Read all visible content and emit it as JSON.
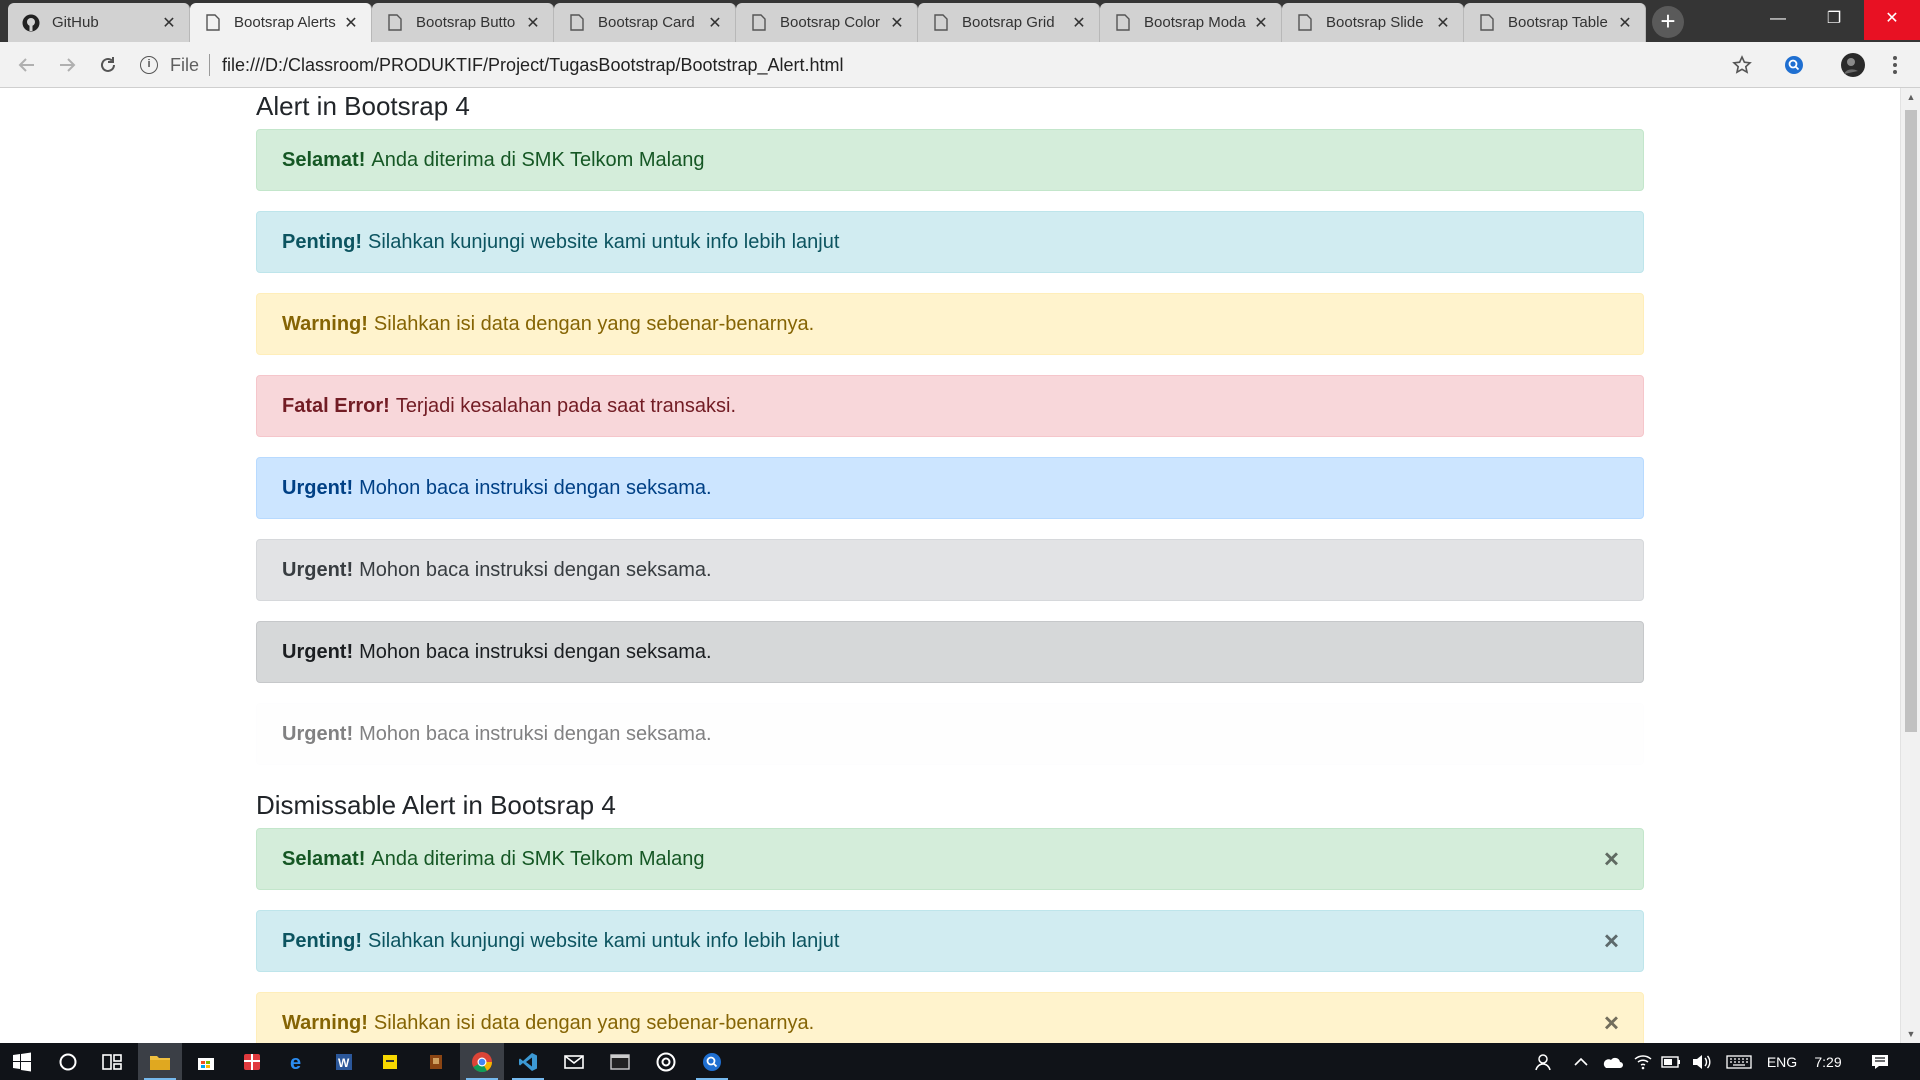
{
  "browser": {
    "tabs": [
      {
        "label": "GitHub",
        "icon": "github-icon",
        "active": false
      },
      {
        "label": "Bootsrap Alerts",
        "icon": "page-icon",
        "active": true
      },
      {
        "label": "Bootsrap Butto",
        "icon": "page-icon",
        "active": false
      },
      {
        "label": "Bootsrap Card",
        "icon": "page-icon",
        "active": false
      },
      {
        "label": "Bootsrap Color",
        "icon": "page-icon",
        "active": false
      },
      {
        "label": "Bootsrap Grid",
        "icon": "page-icon",
        "active": false
      },
      {
        "label": "Bootsrap Moda",
        "icon": "page-icon",
        "active": false
      },
      {
        "label": "Bootsrap Slide",
        "icon": "page-icon",
        "active": false
      },
      {
        "label": "Bootsrap Table",
        "icon": "page-icon",
        "active": false
      }
    ],
    "address": {
      "scheme_label": "File",
      "url": "file:///D:/Classroom/PRODUKTIF/Project/TugasBootstrap/Bootstrap_Alert.html"
    }
  },
  "page": {
    "heading_alerts": "Alert in Bootsrap 4",
    "heading_dismissable": "Dismissable Alert in Bootsrap 4",
    "alerts": [
      {
        "variant": "success",
        "strong": "Selamat!",
        "text": "Anda diterima di SMK Telkom Malang"
      },
      {
        "variant": "info",
        "strong": "Penting!",
        "text": "Silahkan kunjungi website kami untuk info lebih lanjut"
      },
      {
        "variant": "warning",
        "strong": "Warning!",
        "text": "Silahkan isi data dengan yang sebenar-benarnya."
      },
      {
        "variant": "danger",
        "strong": "Fatal Error!",
        "text": "Terjadi kesalahan pada saat transaksi."
      },
      {
        "variant": "primary",
        "strong": "Urgent!",
        "text": "Mohon baca instruksi dengan seksama."
      },
      {
        "variant": "secondary",
        "strong": "Urgent!",
        "text": "Mohon baca instruksi dengan seksama."
      },
      {
        "variant": "dark",
        "strong": "Urgent!",
        "text": "Mohon baca instruksi dengan seksama."
      },
      {
        "variant": "light",
        "strong": "Urgent!",
        "text": "Mohon baca instruksi dengan seksama."
      }
    ],
    "dismissable_alerts": [
      {
        "variant": "success",
        "strong": "Selamat!",
        "text": "Anda diterima di SMK Telkom Malang",
        "close": "×"
      },
      {
        "variant": "info",
        "strong": "Penting!",
        "text": "Silahkan kunjungi website kami untuk info lebih lanjut",
        "close": "×"
      },
      {
        "variant": "warning",
        "strong": "Warning!",
        "text": "Silahkan isi data dengan yang sebenar-benarnya.",
        "close": "×"
      }
    ]
  },
  "taskbar": {
    "language": "ENG",
    "time": "7:29",
    "apps": [
      "start-icon",
      "cortana-icon",
      "task-view-icon",
      "file-explorer-icon",
      "store-icon",
      "gift-icon",
      "edge-icon",
      "word-icon",
      "sticky-notes-icon",
      "app-icon",
      "chrome-icon",
      "vscode-icon",
      "mail-icon",
      "terminal-icon",
      "settings-icon",
      "search-app-icon"
    ]
  }
}
